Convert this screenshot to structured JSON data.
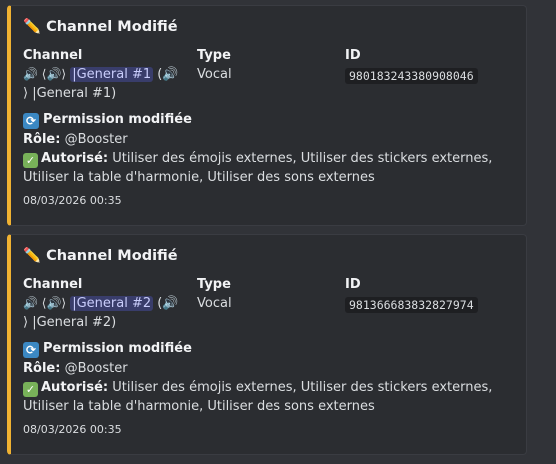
{
  "embeds": [
    {
      "title": "Channel Modifié",
      "title_icon": "pencil-icon",
      "field_channel_label": "Channel",
      "field_type_label": "Type",
      "field_id_label": "ID",
      "channel_prefix": "🔊 ⟨🔊⟩",
      "channel_mention": "|General #1",
      "channel_mid": "(🔊",
      "channel_suffix": "⟩ |General #1)",
      "type_value": "Vocal",
      "id_value": "980183243380908046",
      "perm_title": "Permission modifiée",
      "role_label": "Rôle:",
      "role_value": "@Booster",
      "auth_label": "Autorisé:",
      "auth_value": "Utiliser des émojis externes, Utiliser des stickers externes, Utiliser la table d'harmonie, Utiliser des sons externes",
      "timestamp": "08/03/2026 00:35"
    },
    {
      "title": "Channel Modifié",
      "title_icon": "pencil-icon",
      "field_channel_label": "Channel",
      "field_type_label": "Type",
      "field_id_label": "ID",
      "channel_prefix": "🔊 ⟨🔊⟩",
      "channel_mention": "|General #2",
      "channel_mid": "(🔊",
      "channel_suffix": "⟩ |General #2)",
      "type_value": "Vocal",
      "id_value": "981366683832827974",
      "perm_title": "Permission modifiée",
      "role_label": "Rôle:",
      "role_value": "@Booster",
      "auth_label": "Autorisé:",
      "auth_value": "Utiliser des émojis externes, Utiliser des stickers externes, Utiliser la table d'harmonie, Utiliser des sons externes",
      "timestamp": "08/03/2026 00:35"
    }
  ],
  "colors": {
    "background": "#313338",
    "embed_background": "#2b2d31",
    "embed_accent": "#f0b232",
    "mention_text": "#c9cdfb"
  }
}
